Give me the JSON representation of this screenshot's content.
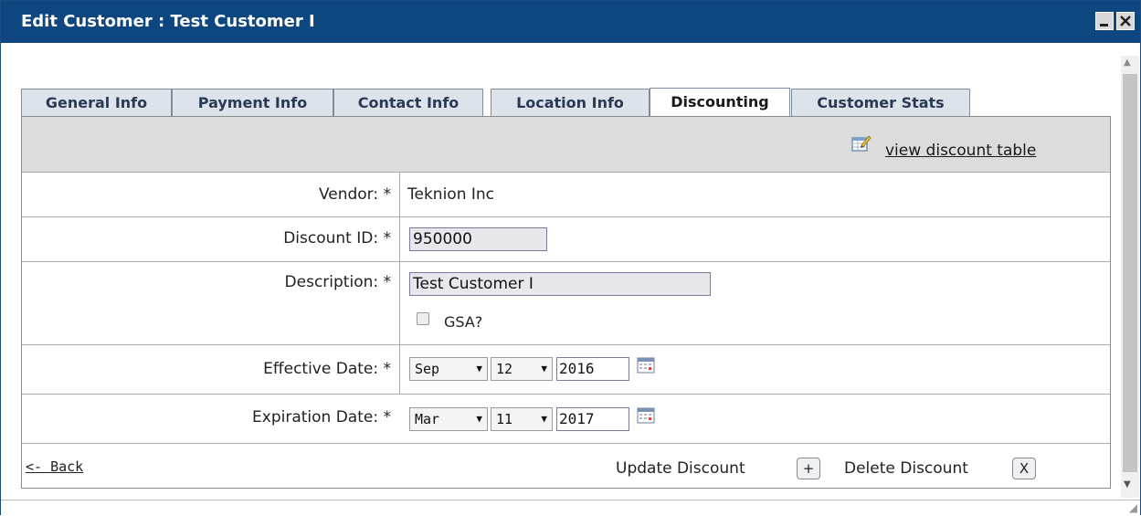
{
  "window": {
    "title": "Edit Customer : Test Customer I"
  },
  "tabs": [
    {
      "label": "General Info"
    },
    {
      "label": "Payment Info"
    },
    {
      "label": "Contact Info"
    },
    {
      "label": "Location Info"
    },
    {
      "label": "Discounting",
      "active": true
    },
    {
      "label": "Customer Stats"
    }
  ],
  "toolbar": {
    "view_discount_table": "view discount table"
  },
  "form": {
    "vendor": {
      "label": "Vendor: *",
      "value": "Teknion Inc"
    },
    "discount_id": {
      "label": "Discount ID: *",
      "value": "950000"
    },
    "description": {
      "label": "Description: *",
      "value": "Test Customer I"
    },
    "gsa": {
      "label": "GSA?",
      "checked": false
    },
    "effective_date": {
      "label": "Effective Date: *",
      "month": "Sep",
      "day": "12",
      "year": "2016"
    },
    "expiration_date": {
      "label": "Expiration Date: *",
      "month": "Mar",
      "day": "11",
      "year": "2017"
    }
  },
  "footer": {
    "back": "<- Back",
    "update_label": "Update Discount",
    "update_button": "+",
    "delete_label": "Delete Discount",
    "delete_button": "X"
  },
  "icons": {
    "minimize": "minimize-icon",
    "close": "close-icon",
    "edit": "edit-table-icon",
    "calendar": "calendar-icon"
  },
  "colors": {
    "titlebar": "#0e4680",
    "panel_header": "#dcdcdc",
    "tab_inactive": "#dde3ea"
  }
}
